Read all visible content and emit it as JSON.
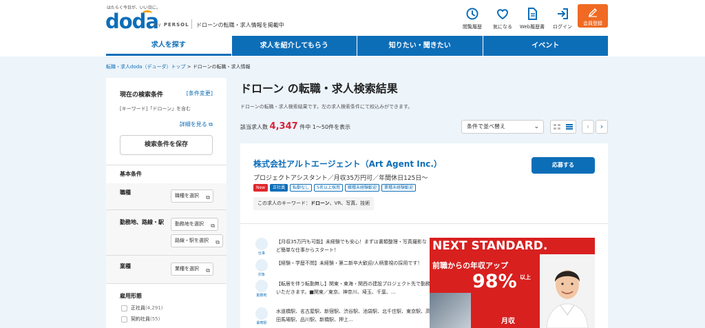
{
  "header": {
    "tagline": "はたらく今日が、いい日に。",
    "logo": "doda",
    "byline_prefix": "by",
    "byline_brand": "PERSOL",
    "description": "ドローンの転職・求人情報を掲載中",
    "nav": [
      {
        "label": "閲覧履歴",
        "icon": "clock-icon"
      },
      {
        "label": "気になる",
        "icon": "heart-icon"
      },
      {
        "label": "Web履歴書",
        "icon": "document-icon"
      },
      {
        "label": "ログイン",
        "icon": "login-icon"
      }
    ],
    "register_label": "会員登録"
  },
  "tabs": [
    {
      "label": "求人を探す",
      "active": true
    },
    {
      "label": "求人を紹介してもらう",
      "active": false
    },
    {
      "label": "知りたい・聞きたい",
      "active": false
    },
    {
      "label": "イベント",
      "active": false
    }
  ],
  "breadcrumb": {
    "home": "転職・求人doda（デューダ）トップ",
    "separator": ">",
    "current": "ドローンの転職・求人情報"
  },
  "sidebar": {
    "title": "現在の検索条件",
    "change_link": "[条件変更]",
    "keyword_line": "[キーワード]「ドローン」を含む",
    "detail_link": "詳細を見る",
    "save_button": "検索条件を保存",
    "basic_title": "基本条件",
    "conditions": [
      {
        "label": "職種",
        "buttons": [
          "職種を選択"
        ]
      },
      {
        "label": "勤務地、路線・駅",
        "buttons": [
          "勤務地を選択",
          "路線・駅を選択"
        ]
      },
      {
        "label": "業種",
        "buttons": [
          "業種を選択"
        ]
      }
    ],
    "employment_title": "雇用形態",
    "employment": [
      {
        "label": "正社員",
        "count": "(4,291)"
      },
      {
        "label": "契約社員",
        "count": "(55)"
      }
    ]
  },
  "main": {
    "title": "ドローン の転職・求人検索結果",
    "subtitle": "ドローンの転職・求人検索結果です。左の求人検索条件にて絞込みができます。",
    "count_prefix": "該当求人数",
    "count": "4,347",
    "count_suffix": "件中 1～50件を表示",
    "sort_label": "条件で並べ替え",
    "accent": "#0d6eb8",
    "count_color": "#d6243a"
  },
  "job": {
    "company": "株式会社アルトエージェント（Art Agent Inc.）",
    "apply": "応募する",
    "title": "プロジェクトアシスタント／月収35万円可／年間休日125日～",
    "tags": [
      "New",
      "正社員",
      "転勤なし",
      "5名以上採用",
      "職種未経験歓迎",
      "業種未経験歓迎"
    ],
    "keyword_prefix": "この求人のキーワード：",
    "keyword_bold": "ドローン",
    "keyword_rest": "、VR、写真、技術",
    "features": [
      {
        "icon": "briefcase-icon",
        "label": "仕事",
        "text": "【月収35万円も可能】未経験でも安心！まずは書類整理・写真撮影など簡単な仕事からスタート！"
      },
      {
        "icon": "person-icon",
        "label": "対象",
        "text": "【経験・学歴不問】未経験・第二新卒大歓迎/人柄重視の採用です！"
      },
      {
        "icon": "pin-icon",
        "label": "勤務地",
        "text": "【転居を伴う転勤無し】関東・東海・関西の建設プロジェクト先で勤務いただきます。■関東／東京、神奈川、埼玉、千葉、…"
      },
      {
        "icon": "train-icon",
        "label": "最寄駅",
        "text": "水道橋駅、名古屋駅、新宿駅、渋谷駅、池袋駅、北千住駅、東京駅、高田馬場駅、品川駅、新橋駅、押上…"
      }
    ],
    "banner": {
      "title": "NEXT STANDARD.",
      "sub": "前職からの年収アップ",
      "percent": "98%",
      "percent_suffix": "以上",
      "tail": "月収"
    }
  }
}
